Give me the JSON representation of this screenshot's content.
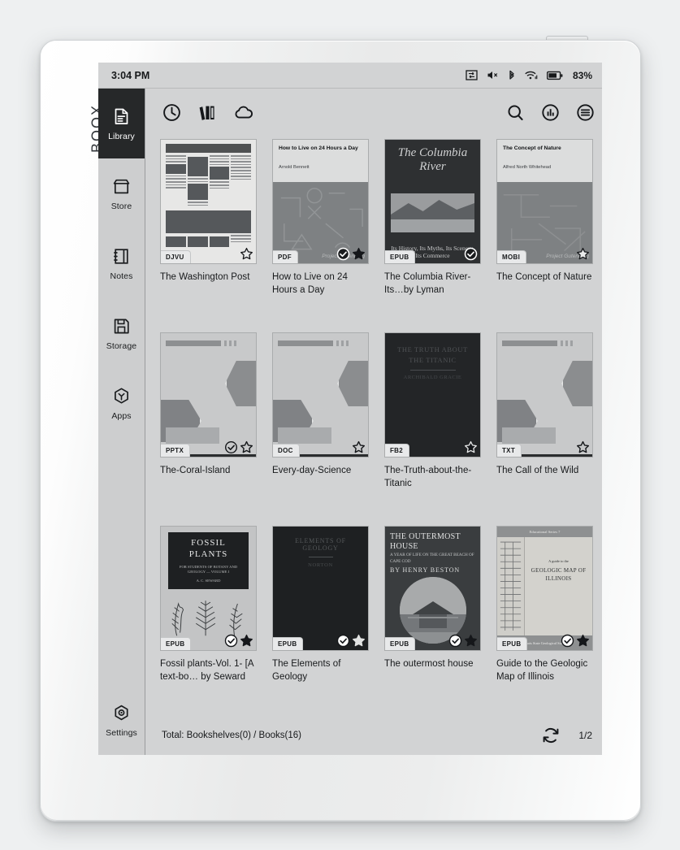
{
  "device": {
    "brand": "BOOX"
  },
  "status_bar": {
    "time": "3:04 PM",
    "battery_percent": "83%",
    "icons": [
      "screen-refresh-icon",
      "volume-mute-icon",
      "bluetooth-icon",
      "wifi-icon",
      "battery-icon"
    ]
  },
  "sidebar": {
    "items": [
      {
        "label": "Library",
        "icon": "library-icon",
        "active": true
      },
      {
        "label": "Store",
        "icon": "store-icon",
        "active": false
      },
      {
        "label": "Notes",
        "icon": "notes-icon",
        "active": false
      },
      {
        "label": "Storage",
        "icon": "storage-icon",
        "active": false
      },
      {
        "label": "Apps",
        "icon": "apps-icon",
        "active": false
      }
    ],
    "bottom": {
      "label": "Settings",
      "icon": "settings-gear-icon"
    }
  },
  "toolbar": {
    "left_icons": [
      "recent-clock-icon",
      "bookshelf-icon",
      "cloud-icon"
    ],
    "right_icons": [
      "search-icon",
      "sort-icon",
      "menu-icon"
    ]
  },
  "books": [
    {
      "title": "The Washington Post",
      "format": "DJVU",
      "read": false,
      "starred": false,
      "star_filled": false,
      "cover": "newspaper"
    },
    {
      "title": "How to Live on 24 Hours a Day",
      "format": "PDF",
      "read": true,
      "starred": true,
      "star_filled": true,
      "cover": "text-top",
      "cover_title": "How to Live on 24 Hours a Day",
      "cover_author": "Arnold Bennett",
      "cover_footer": "Project Gutenberg"
    },
    {
      "title": "The Columbia River-Its…by Lyman",
      "format": "EPUB",
      "read": true,
      "starred": false,
      "star_filled": false,
      "cover": "columbia",
      "cover_title": "The Columbia River",
      "cover_subtitle": "Its History, Its Myths, Its Scenery, Its Commerce"
    },
    {
      "title": "The Concept of Nature",
      "format": "MOBI",
      "read": false,
      "starred": true,
      "star_filled": false,
      "cover": "text-top",
      "cover_title": "The Concept of Nature",
      "cover_author": "Alfred North Whitehead",
      "cover_footer": "Project Gutenberg"
    },
    {
      "title": "The-Coral-Island",
      "format": "PPTX",
      "read": true,
      "starred": true,
      "star_filled": false,
      "cover": "placeholder"
    },
    {
      "title": "Every-day-Science",
      "format": "DOC",
      "read": false,
      "starred": true,
      "star_filled": false,
      "cover": "placeholder"
    },
    {
      "title": "The-Truth-about-the-Titanic",
      "format": "FB2",
      "read": false,
      "starred": true,
      "star_filled": true,
      "cover": "titanic",
      "cover_title": "THE TRUTH ABOUT THE TITANIC",
      "cover_author": "ARCHIBALD GRACIE"
    },
    {
      "title": "The Call of the Wild",
      "format": "TXT",
      "read": false,
      "starred": true,
      "star_filled": false,
      "cover": "placeholder"
    },
    {
      "title": "Fossil plants-Vol. 1- [A text-bo… by Seward",
      "format": "EPUB",
      "read": true,
      "starred": true,
      "star_filled": true,
      "cover": "fossil",
      "cover_title": "FOSSIL PLANTS",
      "cover_subtitle": "FOR STUDENTS OF BOTANY AND GEOLOGY — VOLUME I",
      "cover_author": "A. C. SEWARD"
    },
    {
      "title": "The Elements of Geology",
      "format": "EPUB",
      "read": true,
      "starred": true,
      "star_filled": true,
      "cover": "elements",
      "cover_title": "ELEMENTS OF GEOLOGY",
      "cover_author": "NORTON"
    },
    {
      "title": "The outermost house",
      "format": "EPUB",
      "read": true,
      "starred": true,
      "star_filled": true,
      "cover": "outermost",
      "cover_title": "THE OUTERMOST HOUSE",
      "cover_subtitle": "A YEAR OF LIFE ON THE GREAT BEACH OF CAPE COD",
      "cover_author": "BY HENRY BESTON"
    },
    {
      "title": "Guide to the Geologic Map of Illinois",
      "format": "EPUB",
      "read": true,
      "starred": true,
      "star_filled": true,
      "cover": "illinois",
      "cover_title": "GEOLOGIC MAP OF ILLINOIS",
      "cover_subtitle": "A guide to the",
      "cover_footer": "Illinois State Geological Survey"
    }
  ],
  "footer": {
    "total_text": "Total: Bookshelves(0) / Books(16)",
    "refresh_icon": "refresh-icon",
    "page_indicator": "1/2"
  }
}
